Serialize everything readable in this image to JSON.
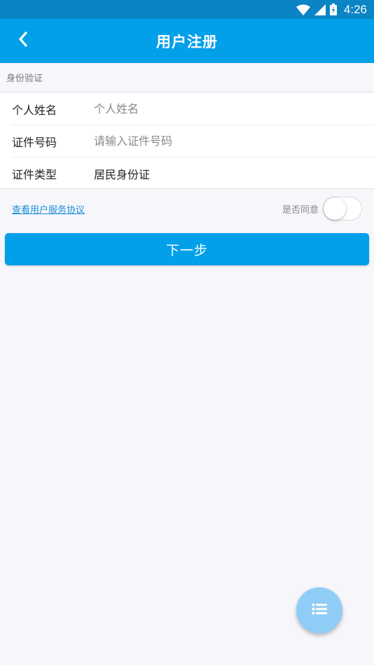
{
  "status_bar": {
    "time": "4:26",
    "icons": [
      "wifi-icon",
      "signal-icon",
      "battery-icon"
    ]
  },
  "app_bar": {
    "back_icon": "chevron-left-icon",
    "title": "用户注册"
  },
  "section": {
    "title": "身份验证"
  },
  "form": {
    "name": {
      "label": "个人姓名",
      "value": "",
      "placeholder": "个人姓名"
    },
    "id_number": {
      "label": "证件号码",
      "value": "",
      "placeholder": "请输入证件号码"
    },
    "id_type": {
      "label": "证件类型",
      "value": "居民身份证"
    }
  },
  "agreement": {
    "link_text": "查看用户服务协议",
    "agree_label": "是否同意",
    "agreed": false
  },
  "next_button": {
    "label": "下一步"
  },
  "fab": {
    "icon": "list-icon"
  },
  "colors": {
    "primary": "#03a0ea",
    "status_bar": "#0a84c5",
    "background": "#f7f6fb",
    "link": "#1b8fd8",
    "fab": "#90cdf6"
  }
}
